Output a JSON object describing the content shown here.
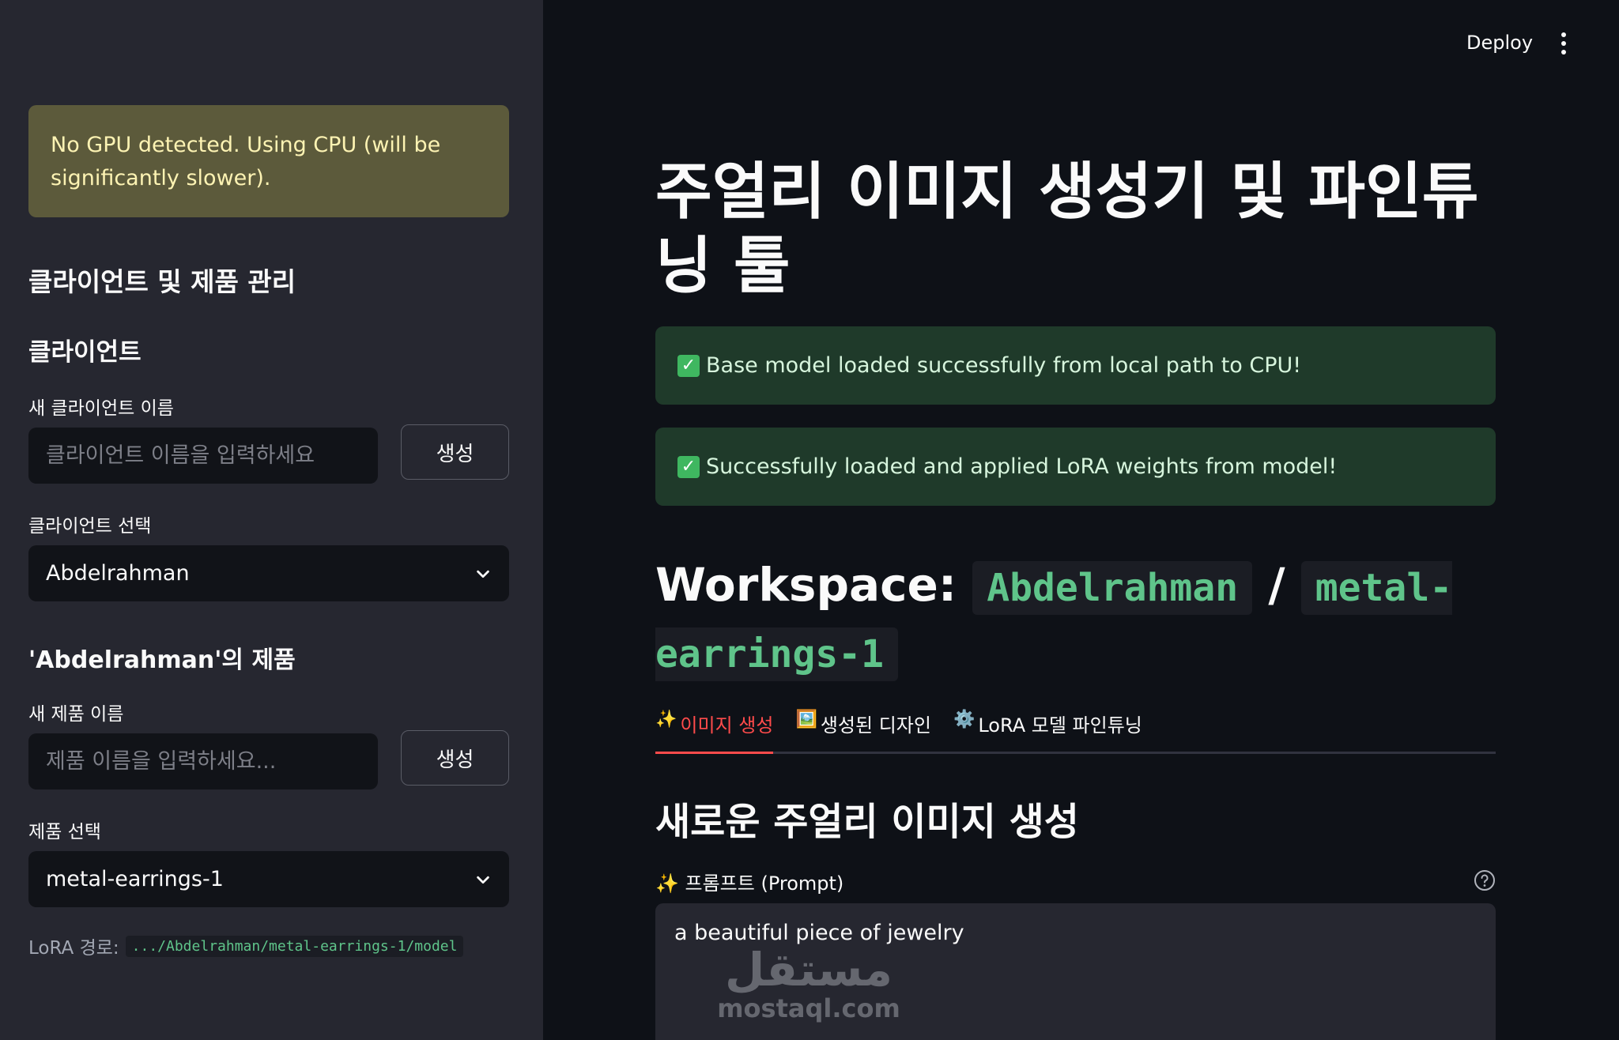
{
  "header": {
    "deploy_label": "Deploy",
    "menu_icon": "kebab-menu-icon"
  },
  "sidebar": {
    "warning": "No GPU detected. Using CPU (will be significantly slower).",
    "section_title": "클라이언트 및 제품 관리",
    "client": {
      "heading": "클라이언트",
      "new_label": "새 클라이언트 이름",
      "new_placeholder": "클라이언트 이름을 입력하세요",
      "create_label": "생성",
      "select_label": "클라이언트 선택",
      "selected": "Abdelrahman"
    },
    "product": {
      "heading": "'Abdelrahman'의 제품",
      "new_label": "새 제품 이름",
      "new_placeholder": "제품 이름을 입력하세요...",
      "create_label": "생성",
      "select_label": "제품 선택",
      "selected": "metal-earrings-1"
    },
    "lora_path_label": "LoRA 경로:",
    "lora_path_value": ".../Abdelrahman/metal-earrings-1/model"
  },
  "main": {
    "title": "주얼리 이미지 생성기 및 파인튜닝 툴",
    "success_messages": [
      "Base model loaded successfully from local path to CPU!",
      "Successfully loaded and applied LoRA weights from model!"
    ],
    "workspace": {
      "label": "Workspace:",
      "client": "Abdelrahman",
      "separator": "/",
      "product": "metal-earrings-1"
    },
    "tabs": [
      {
        "icon": "✨",
        "label": "이미지 생성",
        "active": true
      },
      {
        "icon": "🖼️",
        "label": "생성된 디자인",
        "active": false
      },
      {
        "icon": "⚙️",
        "label": "LoRA 모델 파인튜닝",
        "active": false
      }
    ],
    "section_title": "새로운 주얼리 이미지 생성",
    "prompt_label": "✨ 프롬프트 (Prompt)",
    "prompt_value": "a beautiful piece of jewelry"
  },
  "watermark": {
    "arabic": "مستقل",
    "latin": "mostaql.com"
  },
  "colors": {
    "accent": "#ff4b4b",
    "sidebar_bg": "#262730",
    "main_bg": "#0e1117",
    "success_bg": "#1f3a2a",
    "warning_bg": "#5c5a3b",
    "code_text": "#5fc48a"
  }
}
